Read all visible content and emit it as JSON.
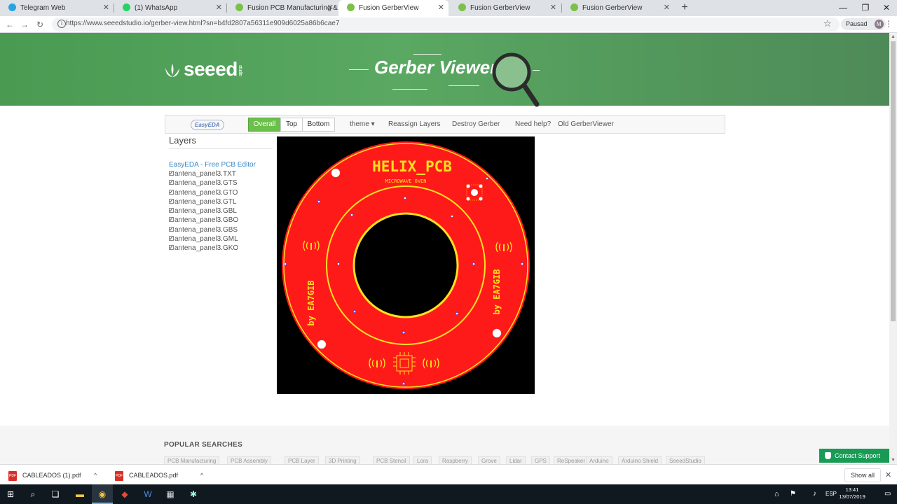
{
  "browser": {
    "tabs": [
      {
        "label": "Telegram Web",
        "favicon_color": "#2aa3e0"
      },
      {
        "label": "(1) WhatsApp",
        "favicon_color": "#25d366"
      },
      {
        "label": "Fusion PCB Manufacturing & Pro",
        "favicon_color": "#7cc04a"
      },
      {
        "label": "Fusion GerberView",
        "favicon_color": "#7cc04a"
      },
      {
        "label": "Fusion GerberView",
        "favicon_color": "#7cc04a"
      },
      {
        "label": "Fusion GerberView",
        "favicon_color": "#7cc04a"
      }
    ],
    "url": "https://www.seeedstudio.io/gerber-view.html?sn=b4fd2807a56311e909d6025a86b6cae7",
    "profile_label": "Pausad",
    "profile_initial": "M"
  },
  "header": {
    "logo_text": "seeed",
    "logo_subtext": "studio",
    "title_text": "Gerber Viewer"
  },
  "toolbar": {
    "easyeda_label": "EasyEDA",
    "view_buttons": [
      "Overall",
      "Top",
      "Bottom"
    ],
    "active_view": "Overall",
    "menu": {
      "theme": "theme ▾",
      "reassign": "Reassign Layers",
      "destroy": "Destroy Gerber",
      "help": "Need help?",
      "old": "Old GerberViewer"
    }
  },
  "layers": {
    "title": "Layers",
    "editor_link": "EasyEDA - Free PCB Editor",
    "items": [
      {
        "name": "antena_panel3.TXT",
        "checked": true
      },
      {
        "name": "antena_panel3.GTS",
        "checked": true
      },
      {
        "name": "antena_panel3.GTO",
        "checked": true
      },
      {
        "name": "antena_panel3.GTL",
        "checked": true
      },
      {
        "name": "antena_panel3.GBL",
        "checked": true
      },
      {
        "name": "antena_panel3.GBO",
        "checked": true
      },
      {
        "name": "antena_panel3.GBS",
        "checked": true
      },
      {
        "name": "antena_panel3.GML",
        "checked": true
      },
      {
        "name": "antena_panel3.GKO",
        "checked": true
      }
    ]
  },
  "pcb": {
    "title": "HELIX_PCB",
    "subtitle": "MICROWAVE OVEN",
    "author_left": "by EA7GIB",
    "author_right": "by EA7GIB",
    "colors": {
      "board": "#ff1a1a",
      "silk": "#ffe020",
      "background": "#000000",
      "pad": "#ffffff"
    }
  },
  "footer": {
    "popular_title": "POPULAR SEARCHES",
    "pills": [
      "PCB Manufacturing",
      "PCB Assembly",
      "PCB Layer",
      "3D Printing",
      "PCB Stencil",
      "Lora",
      "Raspberry",
      "Grove",
      "Lidar",
      "GPS",
      "ReSpeaker",
      "Arduino",
      "Arduino Shield",
      "SeeedStudio"
    ],
    "contact_label": "Contact Support"
  },
  "downloads": {
    "items": [
      "CABLEADOS (1).pdf",
      "CABLEADOS.pdf"
    ],
    "show_all": "Show all"
  },
  "taskbar": {
    "language": "ESP",
    "time": "13:41",
    "date": "13/07/2019"
  }
}
